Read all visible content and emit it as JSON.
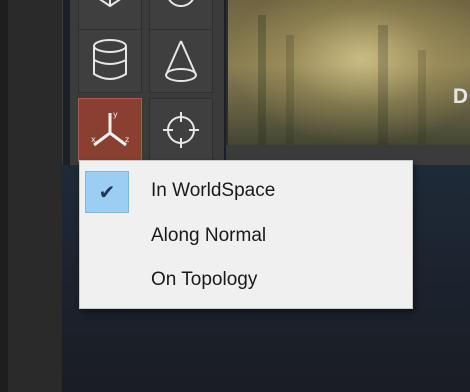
{
  "menu": {
    "items": [
      {
        "label": "In WorldSpace",
        "checked": true
      },
      {
        "label": "Along Normal",
        "checked": false
      },
      {
        "label": "On Topology",
        "checked": false
      }
    ]
  },
  "viewport": {
    "label_fragment": "D"
  },
  "colors": {
    "active_tool": "#8a4030",
    "check_highlight": "#9ccdf2",
    "menu_bg": "#f0f0f0"
  },
  "icons": [
    "cube-icon",
    "sphere-icon",
    "cylinder-icon",
    "cone-icon",
    "axis-worldspace-icon",
    "target-crosshair-icon",
    "check-icon"
  ]
}
